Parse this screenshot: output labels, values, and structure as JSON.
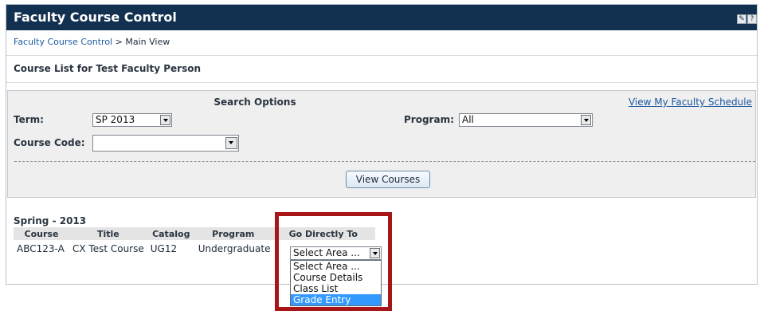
{
  "app": {
    "title": "Faculty Course Control",
    "icons": [
      "tools-icon",
      "help-icon"
    ],
    "help_glyph": "?"
  },
  "breadcrumb": {
    "link": "Faculty Course Control",
    "separator": " > ",
    "current": "Main View"
  },
  "course_list_title": "Course List for Test Faculty Person",
  "search": {
    "title": "Search Options",
    "schedule_link": "View My Faculty Schedule",
    "term_label": "Term:",
    "term_value": "SP 2013",
    "program_label": "Program:",
    "program_value": "All",
    "course_code_label": "Course Code:",
    "course_code_value": "",
    "view_button": "View Courses"
  },
  "results": {
    "term_heading": "Spring - 2013",
    "columns": [
      "Course",
      "Title",
      "Catalog",
      "Program",
      "Go Directly To"
    ],
    "rows": [
      {
        "course": "ABC123-A",
        "title": "CX Test Course",
        "catalog": "UG12",
        "program": "Undergraduate"
      }
    ],
    "goto_selected": "Select Area ...",
    "goto_options": [
      "Select Area ...",
      "Course Details",
      "Class List",
      "Grade Entry"
    ],
    "goto_highlighted": "Grade Entry"
  },
  "colors": {
    "titlebar": "#12304f",
    "link": "#1d5aa0",
    "highlight_box": "#a81516",
    "option_highlight": "#3399ff"
  }
}
